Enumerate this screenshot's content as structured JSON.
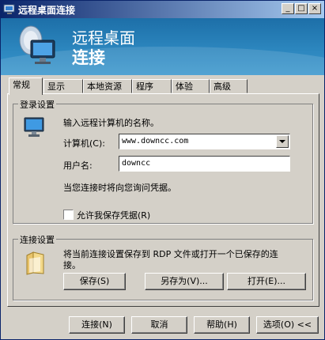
{
  "title": "远程桌面连接",
  "caption_buttons": {
    "minimize": "_",
    "maximize": "□",
    "close": "×"
  },
  "banner": {
    "line1": "远程桌面",
    "line2": "连接"
  },
  "tabs": [
    {
      "label": "常规"
    },
    {
      "label": "显示"
    },
    {
      "label": "本地资源"
    },
    {
      "label": "程序"
    },
    {
      "label": "体验"
    },
    {
      "label": "高级"
    }
  ],
  "login": {
    "legend": "登录设置",
    "instruction": "输入远程计算机的名称。",
    "computer_label": "计算机(C):",
    "computer_value": "www.downcc.com",
    "username_label": "用户名:",
    "username_value": "downcc",
    "credentials_note": "当您连接时将向您询问凭据。",
    "save_credentials_label": "允许我保存凭据(R)",
    "save_credentials_checked": false
  },
  "connection": {
    "legend": "连接设置",
    "description_line1": "将当前连接设置保存到 RDP 文件或打开一个已保存的连",
    "description_line2": "接。",
    "save_button": "保存(S)",
    "save_as_button": "另存为(V)...",
    "open_button": "打开(E)..."
  },
  "footer": {
    "connect_button": "连接(N)",
    "cancel_button": "取消",
    "help_button": "帮助(H)",
    "options_button": "选项(O) <<"
  }
}
